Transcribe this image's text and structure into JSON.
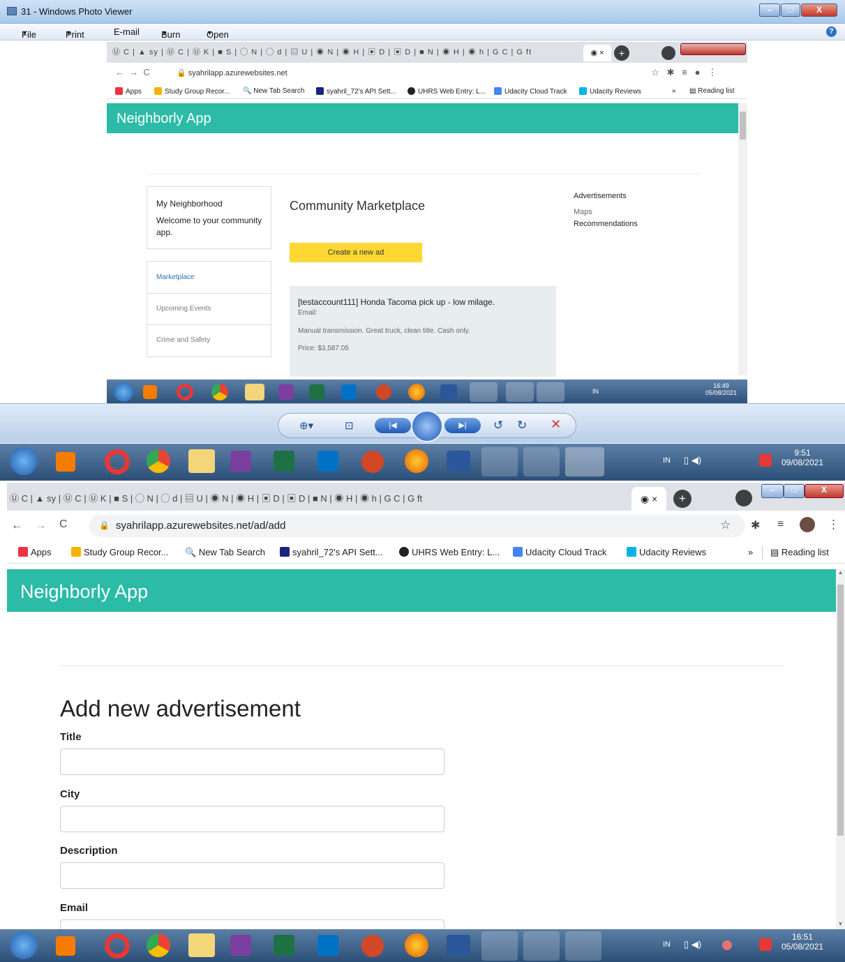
{
  "photo_viewer": {
    "title": "31 - Windows Photo Viewer",
    "menu": [
      "File",
      "Print",
      "E-mail",
      "Burn",
      "Open"
    ],
    "menu_arrows": [
      "▼",
      "▼",
      "",
      "▼",
      "▼"
    ]
  },
  "embedded_browser": {
    "address": "syahrilapp.azurewebsites.net",
    "bookmarks": [
      "Apps",
      "Study Group Recor...",
      "New Tab Search",
      "syahril_72's API Sett...",
      "UHRS Web Entry: L...",
      "Udacity Cloud Track",
      "Udacity Reviews",
      "»",
      "Reading list"
    ],
    "app_title": "Neighborly App",
    "side_card": {
      "title": "My Neighborhood",
      "text": "Welcome to your community app."
    },
    "nav": [
      "Marketplace",
      "Upcoming Events",
      "Crime and Safety"
    ],
    "main_title": "Community Marketplace",
    "create_button": "Create a new ad",
    "listing": {
      "title": "[testaccount111] Honda Tacoma pick up - low milage.",
      "email": "Email:",
      "description": "Manual transmission. Great truck, clean title. Cash only.",
      "price": "Price: $3,587.05"
    },
    "right_links": [
      "Advertisements",
      "Maps",
      "Recommendations"
    ],
    "taskbar_time": "16:49",
    "taskbar_date": "05/08/2021",
    "taskbar_lang": "IN"
  },
  "viewer_taskbar": {
    "time": "9:51",
    "date": "09/08/2021",
    "lang": "IN"
  },
  "browser": {
    "tab_letters": [
      "C",
      "sy",
      "C",
      "K",
      "S",
      "N",
      "d",
      "U",
      "N",
      "H",
      "D",
      "D",
      "N",
      "H",
      "h",
      "C",
      "ft"
    ],
    "active_tab_close": "×",
    "new_tab": "+",
    "address": "syahrilapp.azurewebsites.net/ad/add",
    "bookmarks": [
      "Apps",
      "Study Group Recor...",
      "New Tab Search",
      "syahril_72's API Sett...",
      "UHRS Web Entry: L...",
      "Udacity Cloud Track",
      "Udacity Reviews",
      "»",
      "Reading list"
    ]
  },
  "page": {
    "app_title": "Neighborly App",
    "heading": "Add new advertisement",
    "fields": [
      {
        "label": "Title",
        "value": ""
      },
      {
        "label": "City",
        "value": ""
      },
      {
        "label": "Description",
        "value": ""
      },
      {
        "label": "Email",
        "value": ""
      }
    ]
  },
  "main_taskbar": {
    "time": "16:51",
    "date": "05/08/2021",
    "lang": "IN"
  },
  "colors": {
    "accent": "#2bbba7",
    "button_yellow": "#fdd835",
    "listing_bg": "#e8edf0"
  }
}
